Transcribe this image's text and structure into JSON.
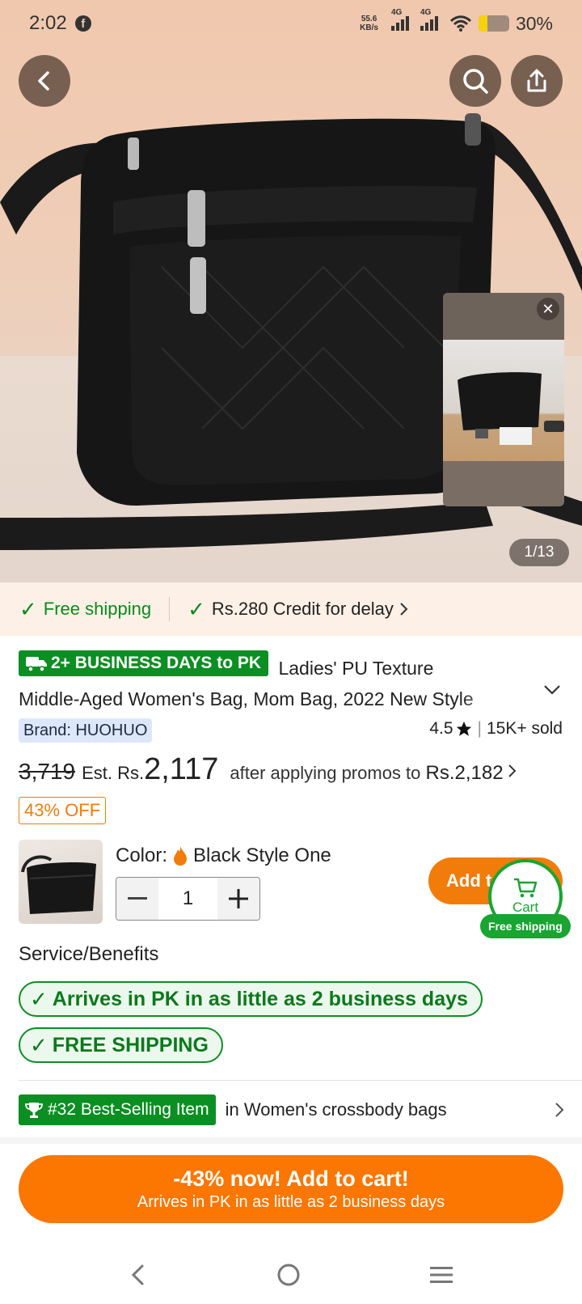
{
  "status_bar": {
    "time": "2:02",
    "net_speed_value": "55.6",
    "net_speed_unit": "KB/s",
    "signal1_label": "4G",
    "signal2_label": "4G",
    "battery": "30%"
  },
  "gallery": {
    "counter": "1/13"
  },
  "shipping_bar": {
    "free_shipping": "Free shipping",
    "credit": "Rs.280 Credit for delay"
  },
  "product": {
    "delivery_badge": "2+ BUSINESS DAYS to PK",
    "title_line1": "Ladies' PU Texture",
    "title_line2": "Middle-Aged Women's Bag, Mom Bag, 2022 New Style",
    "brand": "Brand: HUOHUO",
    "rating": "4.5",
    "sold": "15K+ sold",
    "old_price": "3,719",
    "est_label": "Est. Rs.",
    "price": "2,117",
    "after_text": "after applying promos to",
    "after_price": "Rs.2,182",
    "discount": "43% OFF"
  },
  "sku": {
    "color_label": "Color:",
    "color_value": "Black Style One",
    "quantity": "1",
    "add_button": "Add t",
    "cart_label": "Cart",
    "cart_free": "Free shipping"
  },
  "services": {
    "title": "Service/Benefits",
    "items": [
      "Arrives in PK in as little as 2 business days",
      "FREE SHIPPING"
    ]
  },
  "best_seller": {
    "badge": "#32 Best-Selling Item",
    "category": "in Women's crossbody bags"
  },
  "cta": {
    "line1": "-43% now! Add to cart!",
    "line2": "Arrives in PK in as little as 2 business days"
  },
  "colors": {
    "green": "#0b8f22",
    "orange": "#fb7701"
  }
}
